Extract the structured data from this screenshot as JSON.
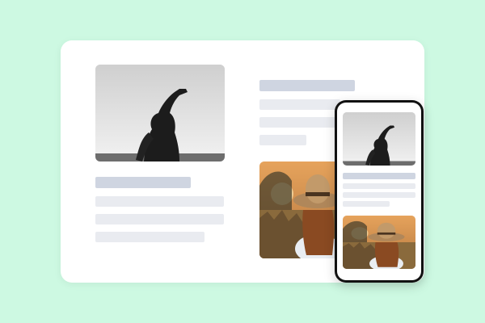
{
  "colors": {
    "background": "#cdf9e2",
    "card": "#ffffff",
    "title_bar": "#cfd5e1",
    "text_line": "#e9ebf0",
    "phone_frame": "#111111"
  },
  "desktop": {
    "hero_image": "silhouette-photo-icon",
    "feature_image": "hat-woman-photo-icon"
  },
  "phone": {
    "hero_image": "silhouette-photo-icon",
    "feature_image": "hat-woman-photo-icon"
  }
}
